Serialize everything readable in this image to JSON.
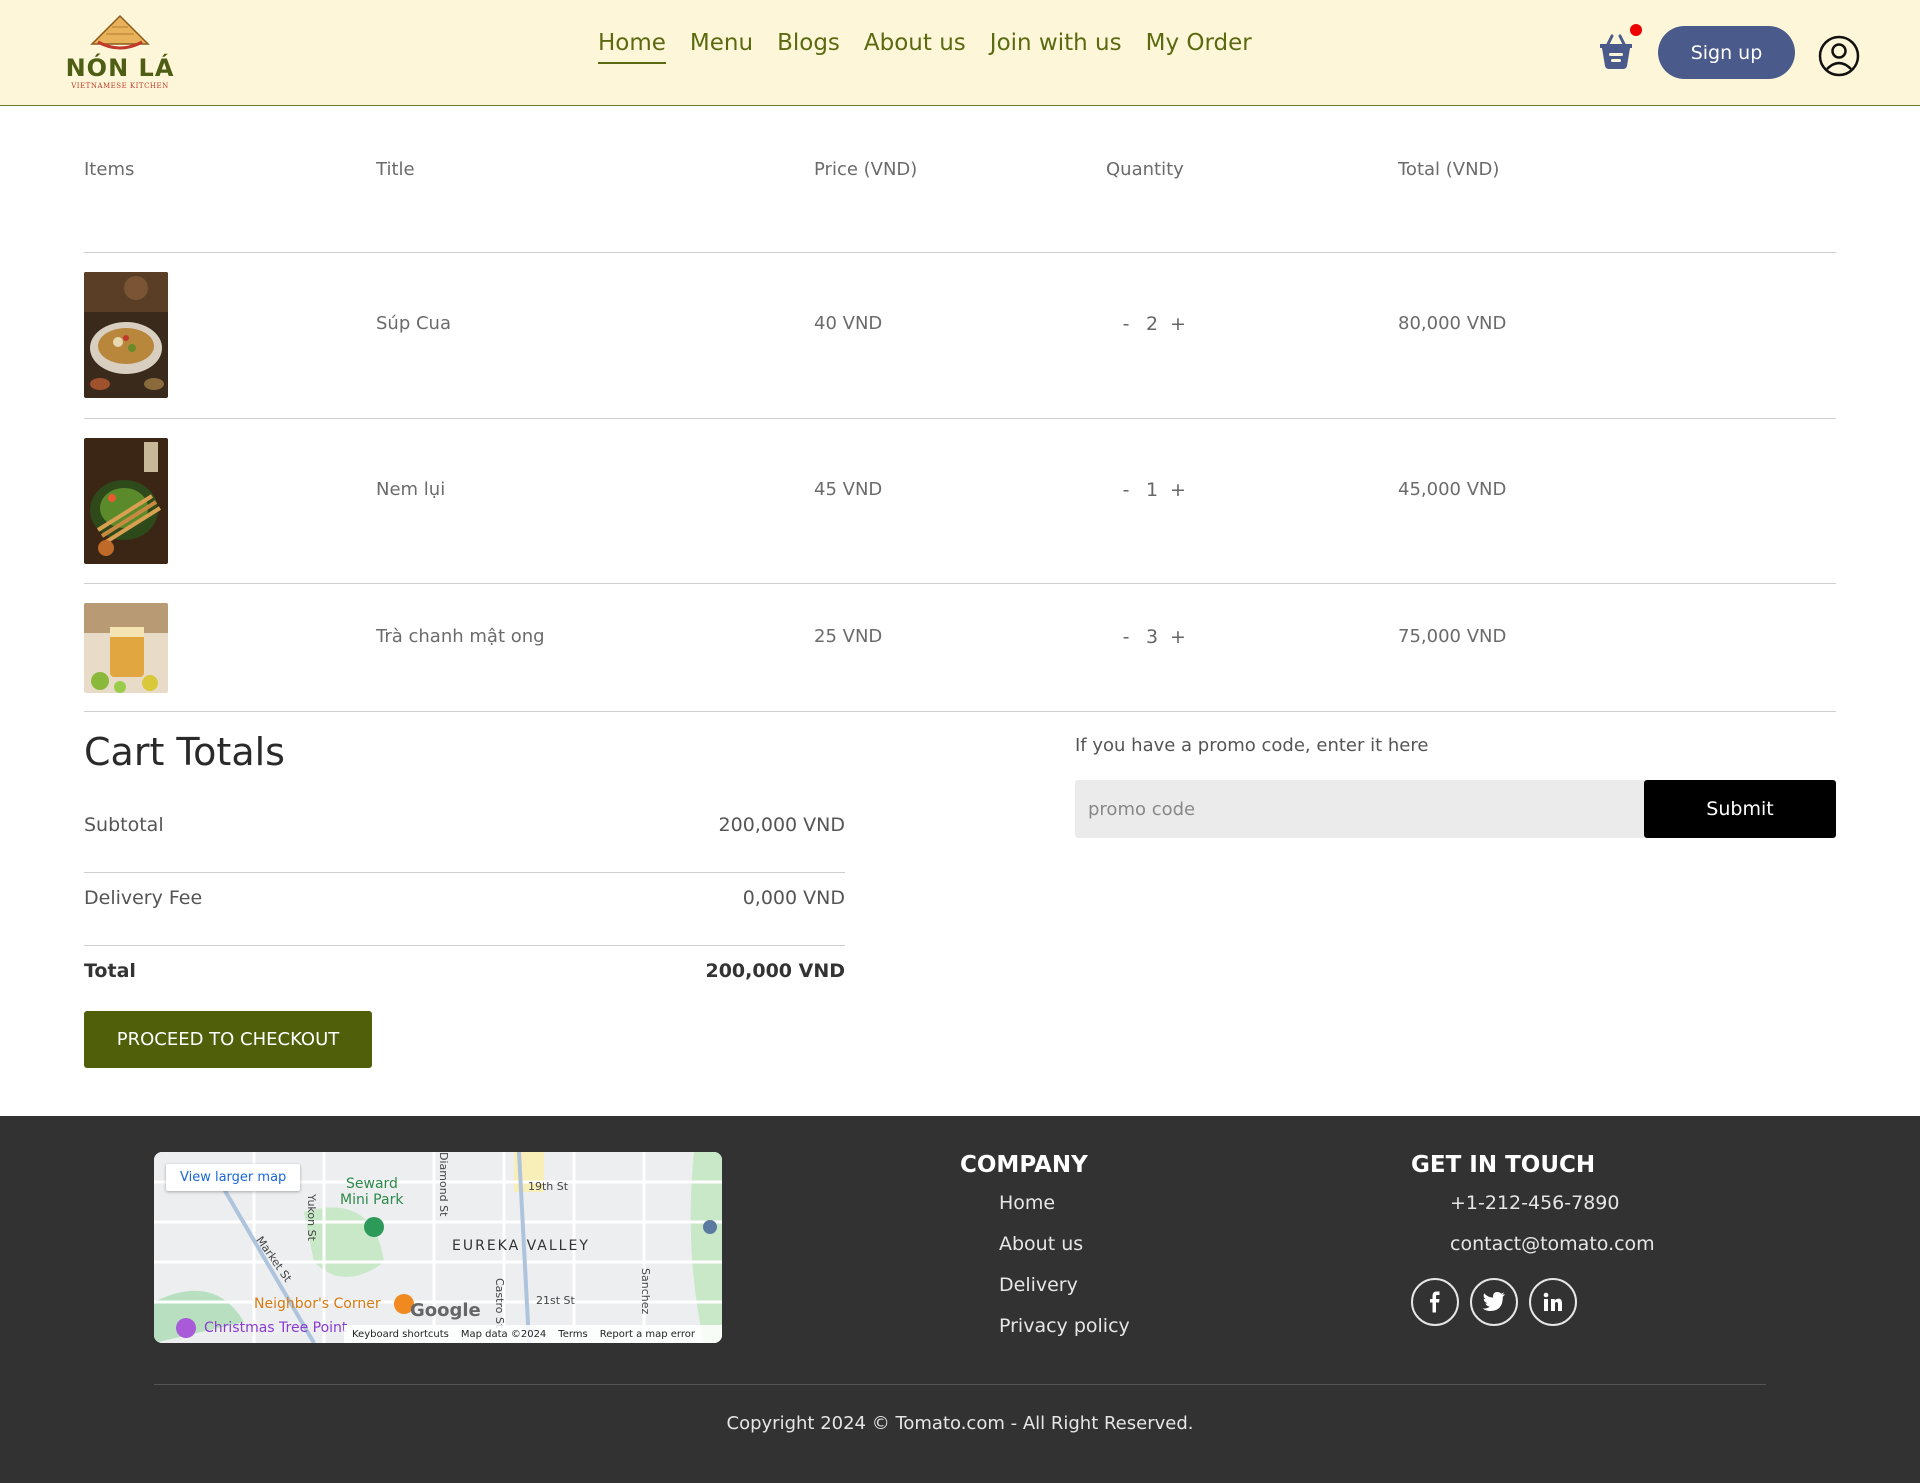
{
  "brand": {
    "name": "NÓN LÁ",
    "tagline": "VIETNAMESE KITCHEN"
  },
  "nav": {
    "items": [
      "Home",
      "Menu",
      "Blogs",
      "About us",
      "Join with us",
      "My Order"
    ],
    "active": "Home"
  },
  "header": {
    "signup_label": "Sign up",
    "cart_icon": "basket-icon",
    "cart_badge_color": "#ee0000",
    "profile_icon": "user-circle-icon"
  },
  "cart": {
    "columns": {
      "items": "Items",
      "title": "Title",
      "price": "Price (VND)",
      "quantity": "Quantity",
      "total": "Total (VND)"
    },
    "decrement_label": "-",
    "increment_label": "+",
    "rows": [
      {
        "title": "Súp Cua",
        "price": "40 VND",
        "quantity": "2",
        "total": "80,000 VND"
      },
      {
        "title": "Nem lụi",
        "price": "45 VND",
        "quantity": "1",
        "total": "45,000 VND"
      },
      {
        "title": "Trà chanh mật ong",
        "price": "25 VND",
        "quantity": "3",
        "total": "75,000 VND"
      }
    ]
  },
  "totals": {
    "title": "Cart Totals",
    "subtotal_label": "Subtotal",
    "subtotal_value": "200,000 VND",
    "delivery_label": "Delivery Fee",
    "delivery_value": "0,000 VND",
    "total_label": "Total",
    "total_value": "200,000 VND",
    "checkout_label": "PROCEED TO CHECKOUT"
  },
  "promo": {
    "label": "If you have a promo code, enter it here",
    "placeholder": "promo code",
    "submit_label": "Submit"
  },
  "footer": {
    "map": {
      "link": "View larger map",
      "labels": [
        "Seward",
        "Mini Park",
        "EUREKA VALLEY",
        "Neighbor's Corner",
        "Christmas Tree Point",
        "19th St",
        "21st St",
        "Castro St",
        "Market St",
        "Sanchez",
        "Yukon St",
        "Diamond St"
      ],
      "google": "Google",
      "footer_links": [
        "Keyboard shortcuts",
        "Map data ©2024",
        "Terms",
        "Report a map error"
      ]
    },
    "company": {
      "title": "COMPANY",
      "links": [
        "Home",
        "About us",
        "Delivery",
        "Privacy policy"
      ]
    },
    "contact": {
      "title": "GET IN TOUCH",
      "phone": "+1-212-456-7890",
      "email": "contact@tomato.com",
      "social": [
        "facebook-icon",
        "twitter-icon",
        "linkedin-icon"
      ]
    },
    "copyright": "Copyright 2024 © Tomato.com - All Right Reserved."
  },
  "colors": {
    "header_bg": "#fdf6d8",
    "accent_green": "#4f5f0a",
    "signup_bg": "#4a5a8a",
    "footer_bg": "#323232"
  }
}
